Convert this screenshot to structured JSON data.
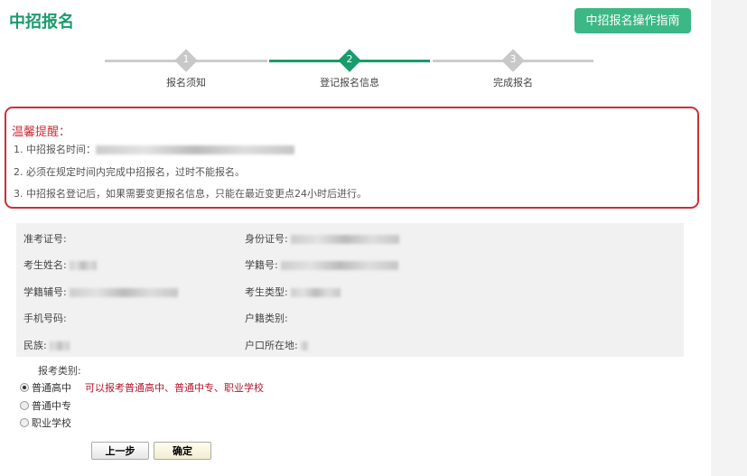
{
  "header": {
    "title": "中招报名",
    "guide_button": "中招报名操作指南"
  },
  "steps": [
    {
      "num": "1",
      "label": "报名须知",
      "active": false
    },
    {
      "num": "2",
      "label": "登记报名信息",
      "active": true
    },
    {
      "num": "3",
      "label": "完成报名",
      "active": false
    }
  ],
  "notice": {
    "title": "温馨提醒：",
    "items": [
      "1. 中招报名时间：",
      "2. 必须在规定时间内完成中招报名，过时不能报名。",
      "3. 中招报名登记后，如果需要变更报名信息，只能在最近变更点24小时后进行。"
    ]
  },
  "info": {
    "exam_no": "准考证号:",
    "id_no": "身份证号:",
    "name": "考生姓名:",
    "student_no": "学籍号:",
    "student_aux_no": "学籍辅号:",
    "student_type": "考生类型:",
    "phone": "手机号码:",
    "household_type": "户籍类别:",
    "ethnicity": "民族:",
    "household_location": "户口所在地:"
  },
  "category": {
    "label": "报考类别:",
    "options": [
      "普通高中",
      "普通中专",
      "职业学校"
    ],
    "selected": "普通高中",
    "hint": "可以报考普通高中、普通中专、职业学校"
  },
  "buttons": {
    "prev": "上一步",
    "confirm": "确定"
  },
  "colors": {
    "brand": "#1a9b6c",
    "alert": "#c9303a"
  }
}
